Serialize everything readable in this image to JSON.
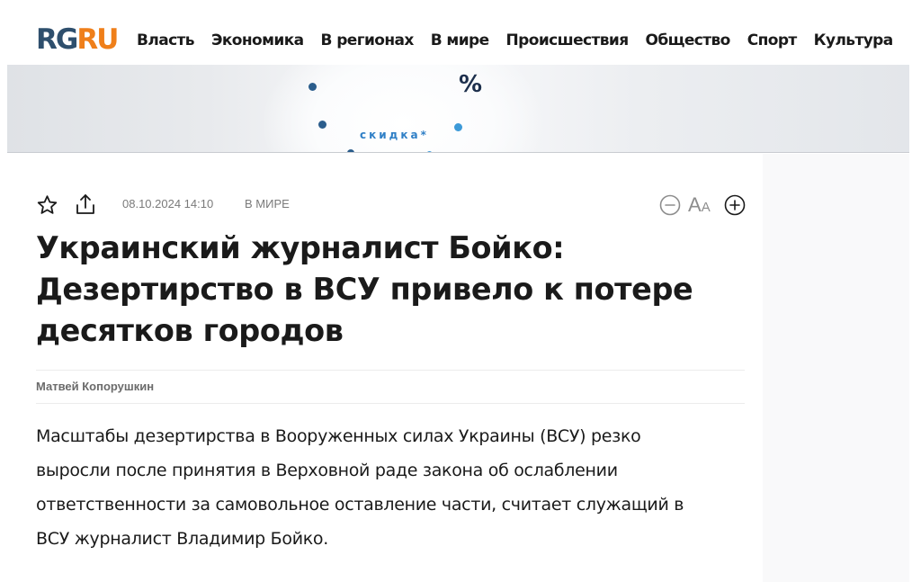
{
  "header": {
    "logo": {
      "rg": "RG",
      "ru": "RU"
    },
    "nav": [
      "Власть",
      "Экономика",
      "В регионах",
      "В мире",
      "Происшествия",
      "Общество",
      "Спорт",
      "Культура"
    ]
  },
  "banner": {
    "percent": "%",
    "skidka": "скидка*"
  },
  "article": {
    "date": "08.10.2024 14:10",
    "rubric": "В МИРЕ",
    "font_label_big": "А",
    "font_label_small": "А",
    "headline": "Украинский журналист Бойко: Дезертирство в ВСУ привело к потере десятков городов",
    "author": "Матвей Копорушкин",
    "lead": "Масштабы дезертирства в Вооруженных силах Украины (ВСУ) резко выросли после принятия в Верховной раде закона об ослаблении ответственности за самовольное оставление части, считает служащий в ВСУ журналист Владимир Бойко."
  },
  "icons": {
    "star": "star-icon",
    "share": "share-icon",
    "font_decrease": "minus-circle-icon",
    "font_increase": "plus-circle-icon"
  },
  "colors": {
    "logo_rg": "#2e4f6d",
    "logo_ru": "#ef7f1a",
    "banner_dot_dark": "#2b5d8c",
    "banner_dot_light": "#3d9ad8"
  }
}
